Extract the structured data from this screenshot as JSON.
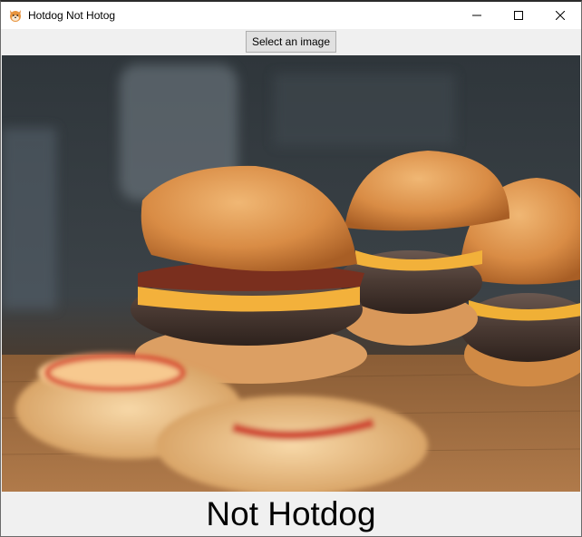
{
  "window": {
    "title": "Hotdog Not Hotog",
    "icon": "shiba-dog-icon"
  },
  "toolbar": {
    "select_label": "Select an image"
  },
  "image": {
    "subject": "burgers-photo"
  },
  "result": {
    "label": "Not Hotdog"
  }
}
